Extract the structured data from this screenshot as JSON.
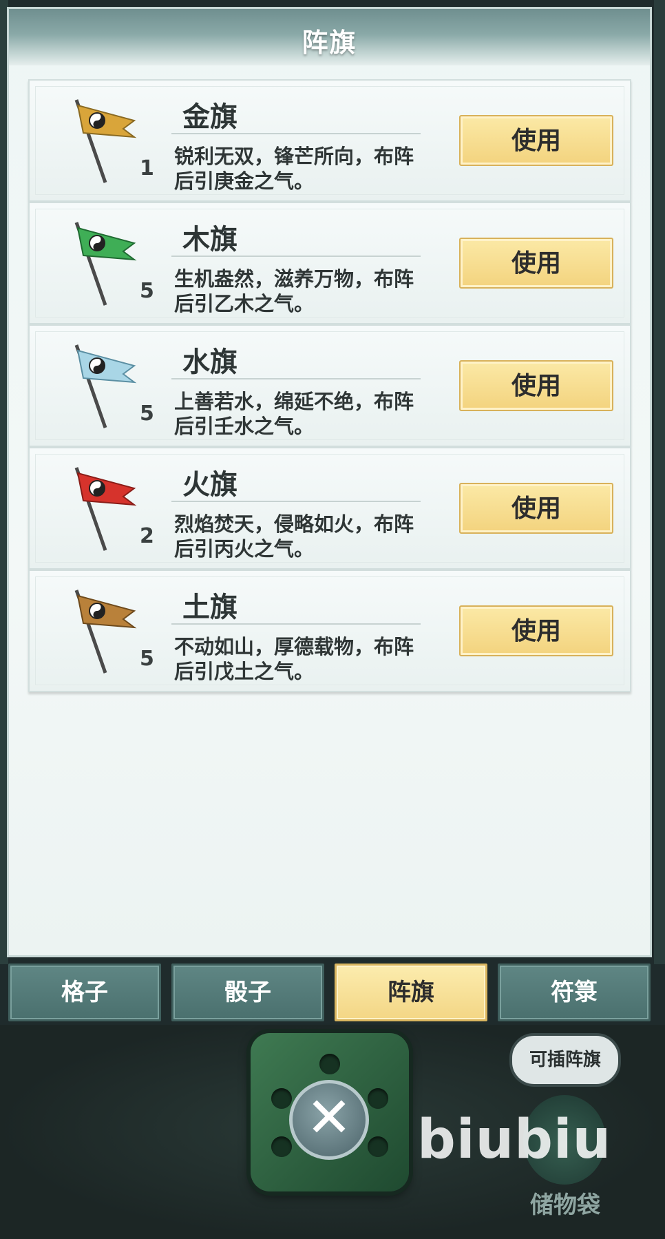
{
  "panel": {
    "title": "阵旗"
  },
  "flags": [
    {
      "name": "金旗",
      "count": "1",
      "desc": "锐利无双，锋芒所向，布阵后引庚金之气。",
      "color": "#d9a53a",
      "icon": "gold-flag-icon"
    },
    {
      "name": "木旗",
      "count": "5",
      "desc": "生机盎然，滋养万物，布阵后引乙木之气。",
      "color": "#3fae56",
      "icon": "wood-flag-icon"
    },
    {
      "name": "水旗",
      "count": "5",
      "desc": "上善若水，绵延不绝，布阵后引壬水之气。",
      "color": "#a9d6e6",
      "icon": "water-flag-icon"
    },
    {
      "name": "火旗",
      "count": "2",
      "desc": "烈焰焚天，侵略如火，布阵后引丙火之气。",
      "color": "#d6332c",
      "icon": "fire-flag-icon"
    },
    {
      "name": "土旗",
      "count": "5",
      "desc": "不动如山，厚德载物，布阵后引戊土之气。",
      "color": "#b9813a",
      "icon": "earth-flag-icon"
    }
  ],
  "use_label": "使用",
  "tabs": [
    {
      "label": "格子",
      "active": false
    },
    {
      "label": "骰子",
      "active": false
    },
    {
      "label": "阵旗",
      "active": true
    },
    {
      "label": "符箓",
      "active": false
    }
  ],
  "bottom": {
    "close_symbol": "✕",
    "bubble_text": "可插阵旗",
    "bag_label": "储物袋",
    "watermark": "biubiu"
  }
}
